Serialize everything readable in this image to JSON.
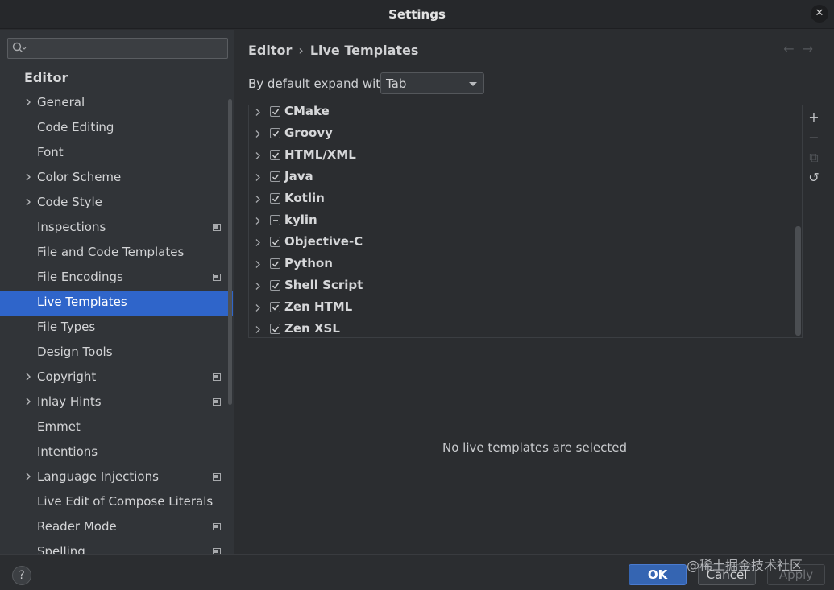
{
  "window": {
    "title": "Settings",
    "close_icon": "close-icon"
  },
  "sidebar": {
    "search": {
      "value": "",
      "placeholder": ""
    },
    "section_title": "Editor",
    "items": [
      {
        "label": "General",
        "expandable": true,
        "badge": false
      },
      {
        "label": "Code Editing",
        "expandable": false,
        "badge": false
      },
      {
        "label": "Font",
        "expandable": false,
        "badge": false
      },
      {
        "label": "Color Scheme",
        "expandable": true,
        "badge": false
      },
      {
        "label": "Code Style",
        "expandable": true,
        "badge": false
      },
      {
        "label": "Inspections",
        "expandable": false,
        "badge": true
      },
      {
        "label": "File and Code Templates",
        "expandable": false,
        "badge": false
      },
      {
        "label": "File Encodings",
        "expandable": false,
        "badge": true
      },
      {
        "label": "Live Templates",
        "expandable": false,
        "badge": false,
        "selected": true
      },
      {
        "label": "File Types",
        "expandable": false,
        "badge": false
      },
      {
        "label": "Design Tools",
        "expandable": false,
        "badge": false
      },
      {
        "label": "Copyright",
        "expandable": true,
        "badge": true
      },
      {
        "label": "Inlay Hints",
        "expandable": true,
        "badge": true
      },
      {
        "label": "Emmet",
        "expandable": false,
        "badge": false
      },
      {
        "label": "Intentions",
        "expandable": false,
        "badge": false
      },
      {
        "label": "Language Injections",
        "expandable": true,
        "badge": true
      },
      {
        "label": "Live Edit of Compose Literals",
        "expandable": false,
        "badge": false
      },
      {
        "label": "Reader Mode",
        "expandable": false,
        "badge": true
      },
      {
        "label": "Spelling",
        "expandable": false,
        "badge": true
      }
    ]
  },
  "main": {
    "breadcrumb": {
      "parent": "Editor",
      "separator": "›",
      "current": "Live Templates"
    },
    "nav_arrows": {
      "back": "←",
      "forward": "→"
    },
    "expand": {
      "label": "By default expand with",
      "value": "Tab"
    },
    "template_groups": [
      {
        "name": "CMake",
        "state": "checked"
      },
      {
        "name": "Groovy",
        "state": "checked"
      },
      {
        "name": "HTML/XML",
        "state": "checked"
      },
      {
        "name": "Java",
        "state": "checked"
      },
      {
        "name": "Kotlin",
        "state": "checked"
      },
      {
        "name": "kylin",
        "state": "partial"
      },
      {
        "name": "Objective-C",
        "state": "checked"
      },
      {
        "name": "Python",
        "state": "checked"
      },
      {
        "name": "Shell Script",
        "state": "checked"
      },
      {
        "name": "Zen HTML",
        "state": "checked"
      },
      {
        "name": "Zen XSL",
        "state": "checked"
      }
    ],
    "tools": {
      "add": "+",
      "remove": "−",
      "copy": "⧉",
      "restore": "↺"
    },
    "empty_message": "No live templates are selected"
  },
  "footer": {
    "help": "?",
    "ok": "OK",
    "cancel": "Cancel",
    "apply": "Apply",
    "watermark": "@稀土掘金技术社区"
  },
  "colors": {
    "accent": "#2f65ca",
    "background": "#2b2d30",
    "sidebar": "#313438"
  }
}
